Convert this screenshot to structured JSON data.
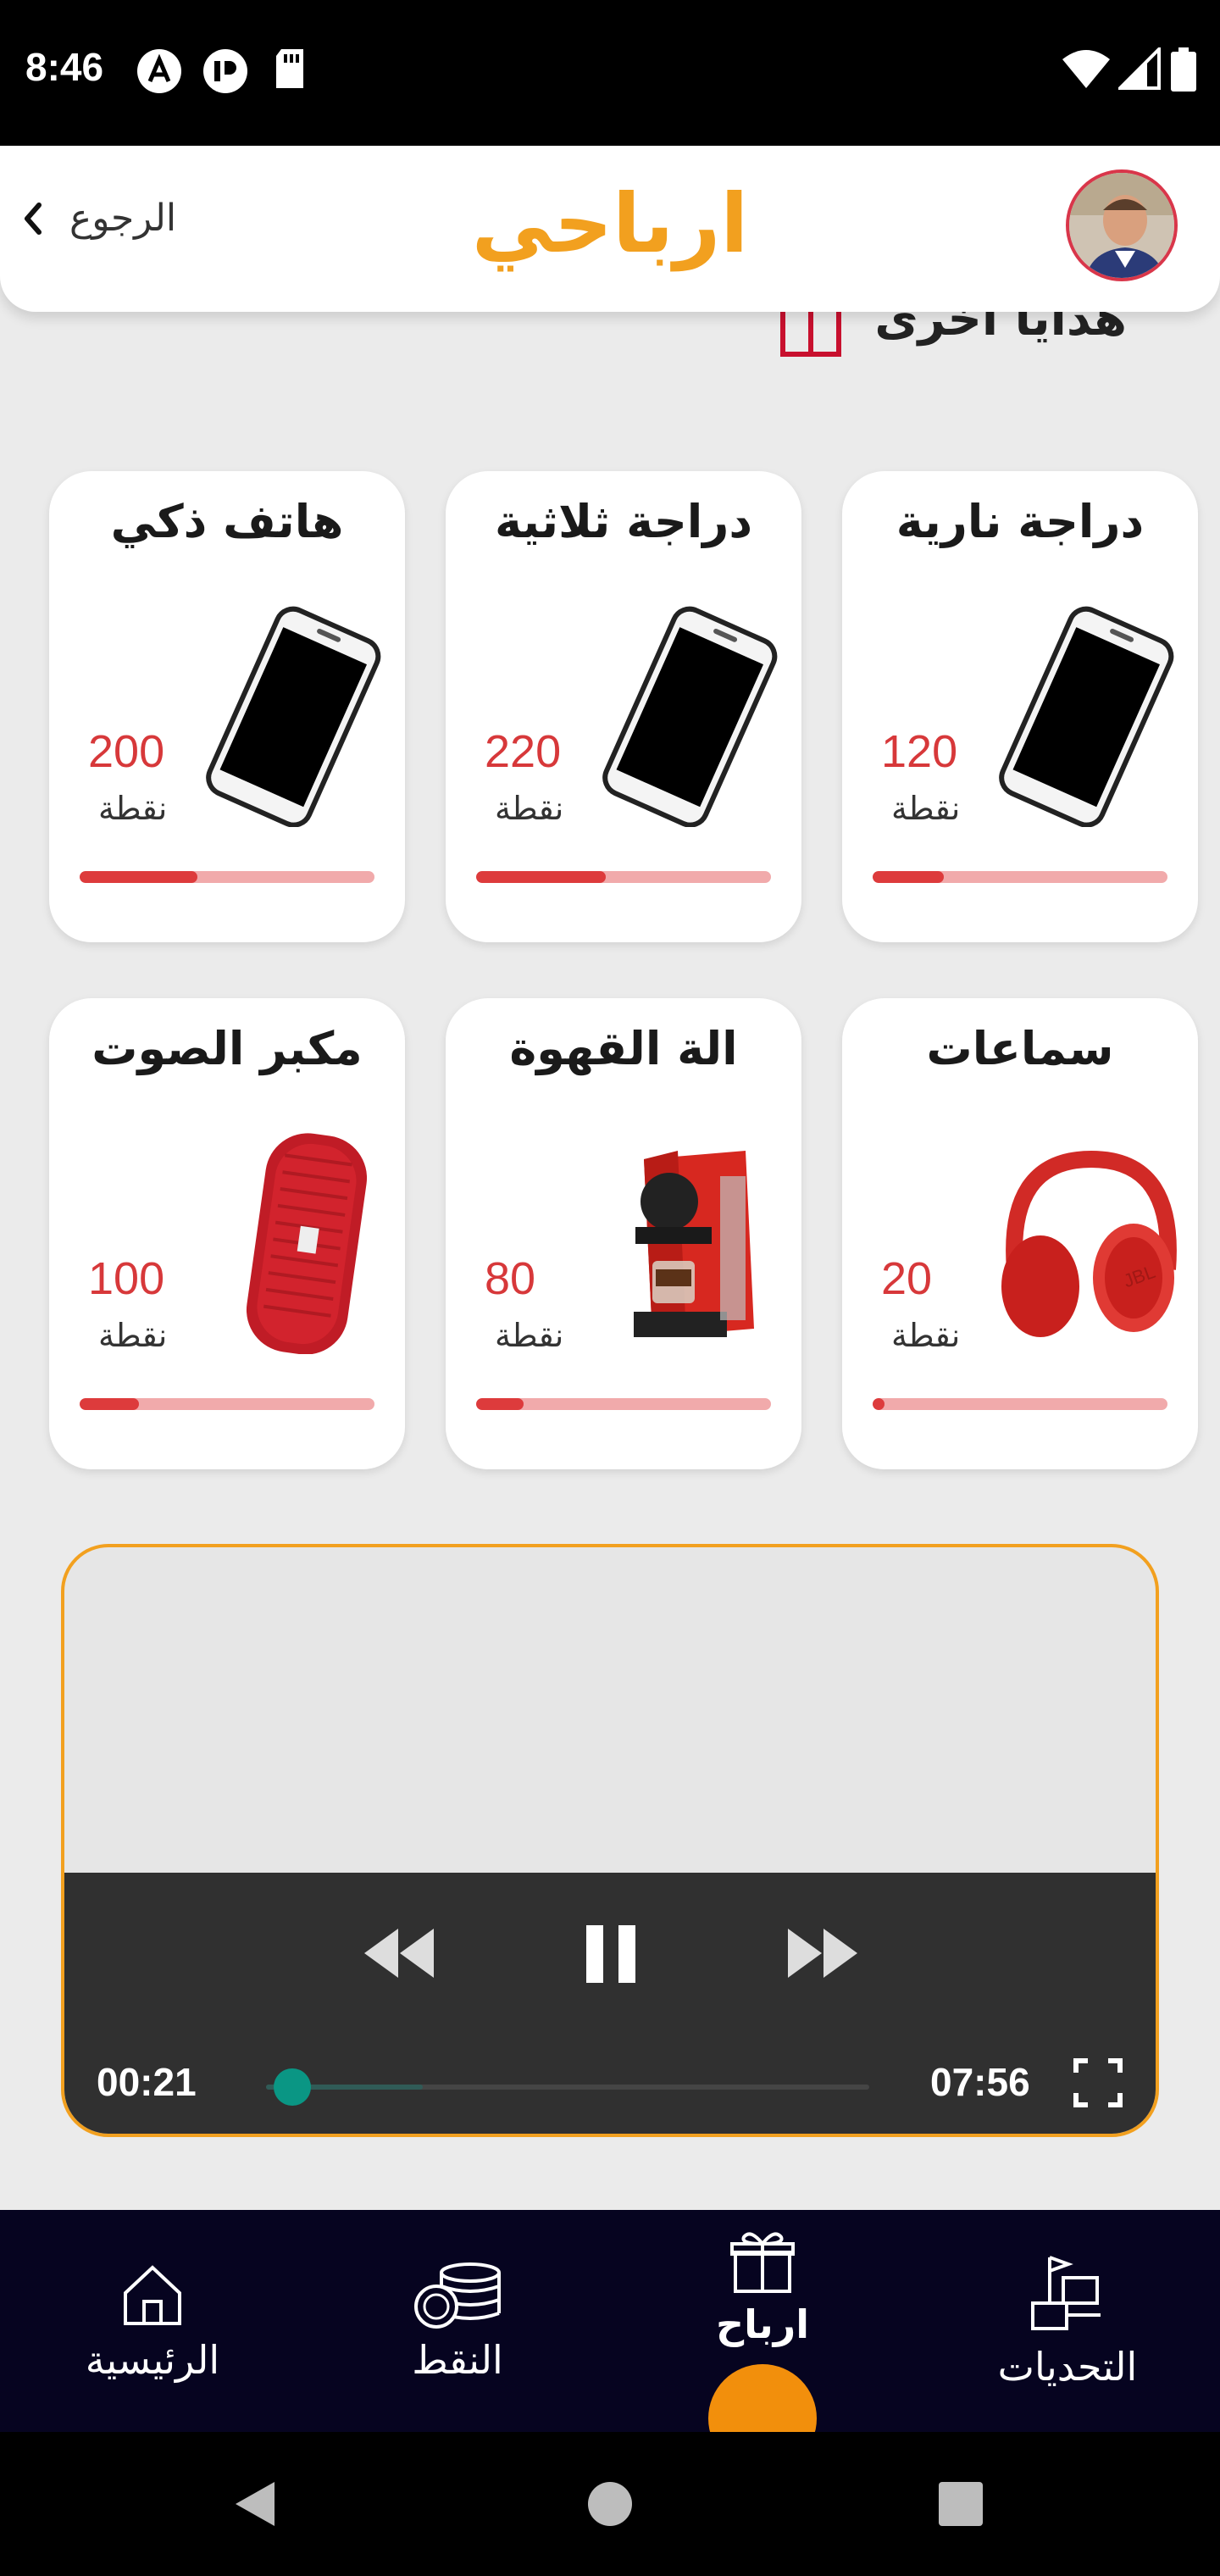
{
  "status_bar": {
    "time": "8:46",
    "icons": [
      "a-circle-icon",
      "p-circle-icon",
      "sd-card-icon",
      "wifi-icon",
      "signal-icon",
      "battery-icon"
    ]
  },
  "header": {
    "back_label": "الرجوع",
    "title": "ارباحي",
    "title_color": "#f2a01f"
  },
  "section": {
    "heading": "هدايا أخرى",
    "icon": "gift-icon"
  },
  "cards": [
    {
      "title": "دراجة نارية",
      "points": "120",
      "unit": "نقطة",
      "progress": 0.24,
      "image": "smartphone-image"
    },
    {
      "title": "دراجة ثلاثية",
      "points": "220",
      "unit": "نقطة",
      "progress": 0.44,
      "image": "smartphone-image"
    },
    {
      "title": "هاتف ذكي",
      "points": "200",
      "unit": "نقطة",
      "progress": 0.4,
      "image": "smartphone-image"
    },
    {
      "title": "سماعات",
      "points": "20",
      "unit": "نقطة",
      "progress": 0.04,
      "image": "headphones-image"
    },
    {
      "title": "الة القهوة",
      "points": "80",
      "unit": "نقطة",
      "progress": 0.16,
      "image": "coffee-machine-image"
    },
    {
      "title": "مكبر الصوت",
      "points": "100",
      "unit": "نقطة",
      "progress": 0.2,
      "image": "speaker-image"
    }
  ],
  "video": {
    "current_time": "00:21",
    "total_time": "07:56",
    "played_fraction": 0.044,
    "buffered_fraction": 0.26,
    "accent": "#f2a01f"
  },
  "bottom_nav": {
    "items": [
      {
        "label": "التحديات",
        "icon": "challenges-icon",
        "active": false
      },
      {
        "label": "ارباح",
        "icon": "gift-icon",
        "active": true
      },
      {
        "label": "النقط",
        "icon": "coins-icon",
        "active": false
      },
      {
        "label": "الرئيسية",
        "icon": "home-icon",
        "active": false
      }
    ],
    "active_color": "#f28f0c"
  },
  "colors": {
    "points_red": "#d7383a",
    "progress_fill": "#dd3b3c",
    "progress_track": "#f1aaab",
    "nav_background": "#060420"
  }
}
